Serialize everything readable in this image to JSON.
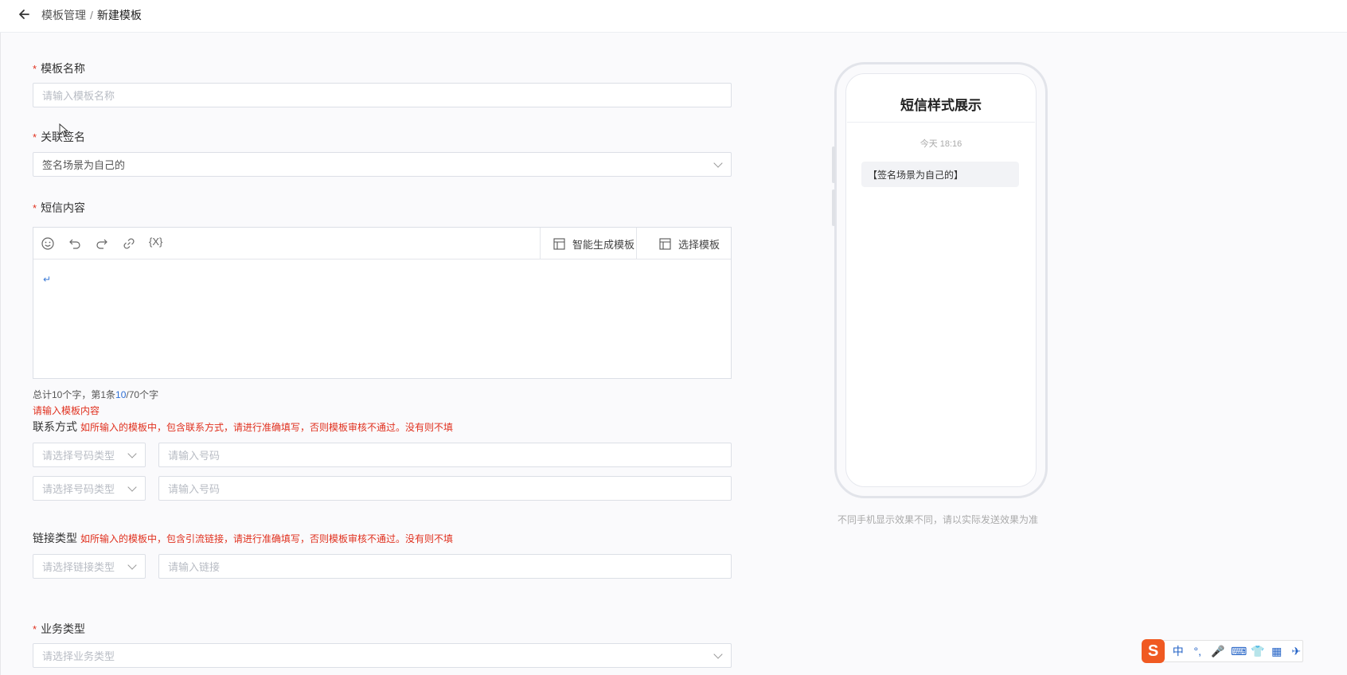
{
  "header": {
    "breadcrumb_parent": "模板管理",
    "separator": "/",
    "breadcrumb_current": "新建模板"
  },
  "form": {
    "template_name": {
      "label": "模板名称",
      "placeholder": "请输入模板名称"
    },
    "signature": {
      "label": "关联签名",
      "value": "签名场景为自己的"
    },
    "sms_content": {
      "label": "短信内容",
      "toolbar": {
        "ai_generate": "智能生成模板",
        "choose_template": "选择模板",
        "variable_icon_text": "{X}"
      },
      "body_text": "↵",
      "count_prefix": "总计10个字，第1条",
      "count_highlight": "10",
      "count_suffix": "/70个字",
      "error": "请输入模板内容"
    },
    "contact": {
      "title": "联系方式",
      "hint": "如所输入的模板中，包含联系方式，请进行准确填写，否则模板审核不通过。没有则不填",
      "type_placeholder": "请选择号码类型",
      "number_placeholder": "请输入号码"
    },
    "link": {
      "title": "链接类型",
      "hint": "如所输入的模板中，包含引流链接，请进行准确填写，否则模板审核不通过。没有则不填",
      "type_placeholder": "请选择链接类型",
      "link_placeholder": "请输入链接"
    },
    "business": {
      "label": "业务类型",
      "placeholder": "请选择业务类型"
    },
    "required_mark": "*"
  },
  "preview": {
    "title": "短信样式展示",
    "time": "今天 18:16",
    "message": "【签名场景为自己的】",
    "note": "不同手机显示效果不同，请以实际发送效果为准"
  },
  "ime": {
    "logo": "S",
    "items": [
      "中",
      "°,",
      "🎤",
      "⌨",
      "👕",
      "▦",
      "✈"
    ]
  },
  "colors": {
    "required": "#e0301e",
    "accent": "#2f6fd4",
    "ime": "#f05a22"
  }
}
